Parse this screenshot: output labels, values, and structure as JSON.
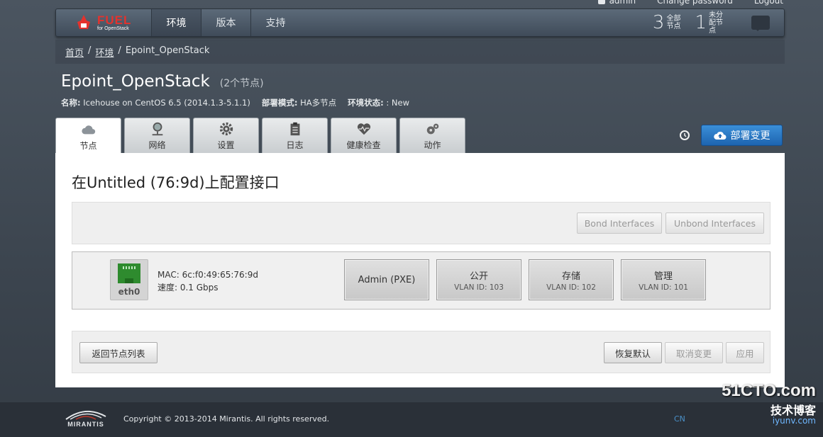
{
  "top_links": {
    "user": "admin",
    "change_password": "Change password",
    "logout": "Logout"
  },
  "nav": {
    "logo_main": "FUEL",
    "logo_sub": "for OpenStack",
    "tabs": [
      "环境",
      "版本",
      "支持"
    ],
    "stats": [
      {
        "num": "3",
        "label": "全部节点"
      },
      {
        "num": "1",
        "label": "未分配节点"
      }
    ]
  },
  "breadcrumb": {
    "home": "首页",
    "sep1": "/",
    "env": "环境",
    "sep2": "/",
    "current": "Epoint_OpenStack"
  },
  "cluster": {
    "name": "Epoint_OpenStack",
    "node_count": "(2个节点)",
    "release_label": "名称:",
    "release_value": "Icehouse on CentOS 6.5 (2014.1.3-5.1.1)",
    "mode_label": "部署模式:",
    "mode_value": "HA多节点",
    "status_label": "环境状态:",
    "status_value": ": New"
  },
  "tabs": [
    {
      "label": "节点",
      "icon": "cloud-icon"
    },
    {
      "label": "网络",
      "icon": "network-icon"
    },
    {
      "label": "设置",
      "icon": "gear-icon"
    },
    {
      "label": "日志",
      "icon": "clipboard-icon"
    },
    {
      "label": "健康检查",
      "icon": "heartbeat-icon"
    },
    {
      "label": "动作",
      "icon": "cogs-icon"
    }
  ],
  "deploy_button": "部署变更",
  "panel": {
    "title": "在Untitled (76:9d)上配置接口",
    "bond_button": "Bond Interfaces",
    "unbond_button": "Unbond Interfaces",
    "interface": {
      "name": "eth0",
      "mac": "MAC: 6c:f0:49:65:76:9d",
      "speed": "速度: 0.1 Gbps",
      "networks": [
        {
          "name": "Admin (PXE)",
          "vlan": ""
        },
        {
          "name": "公开",
          "vlan": "VLAN ID: 103"
        },
        {
          "name": "存储",
          "vlan": "VLAN ID: 102"
        },
        {
          "name": "管理",
          "vlan": "VLAN ID: 101"
        }
      ]
    },
    "back_button": "返回节点列表",
    "reset_button": "恢复默认",
    "cancel_button": "取消变更",
    "apply_button": "应用"
  },
  "footer": {
    "brand": "MIRANTIS",
    "copyright": "Copyright © 2013-2014 Mirantis. All rights reserved.",
    "lang": "CN"
  },
  "watermark": {
    "line1": "51CTO.com",
    "line2": "技术博客",
    "line3": "iyunv.com"
  }
}
